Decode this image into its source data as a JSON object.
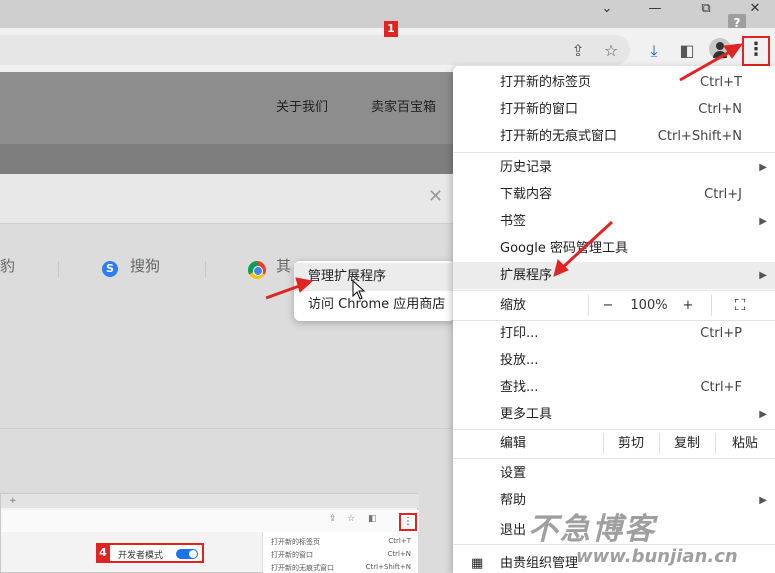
{
  "window": {
    "help": "?",
    "minimize": "⌄",
    "maximize": "—",
    "close": "⧉",
    "quit": "✕"
  },
  "toolbar": {
    "share_icon": "share-icon",
    "star_icon": "star-icon",
    "download_icon": "download-icon",
    "sidepanel_icon": "side-panel-icon",
    "menu_icon": "⋮"
  },
  "site": {
    "nav": [
      "关于我们",
      "卖家百宝箱"
    ]
  },
  "search": {
    "engines": [
      "豹",
      "搜狗",
      "其"
    ]
  },
  "extensions_submenu": {
    "items": [
      "管理扩展程序",
      "访问 Chrome 应用商店"
    ]
  },
  "menu": {
    "group1": [
      {
        "label": "打开新的标签页",
        "shortcut": "Ctrl+T"
      },
      {
        "label": "打开新的窗口",
        "shortcut": "Ctrl+N"
      },
      {
        "label": "打开新的无痕式窗口",
        "shortcut": "Ctrl+Shift+N"
      }
    ],
    "group2": [
      {
        "label": "历史记录",
        "shortcut": ""
      },
      {
        "label": "下载内容",
        "shortcut": "Ctrl+J"
      },
      {
        "label": "书签",
        "shortcut": ""
      },
      {
        "label": "Google 密码管理工具",
        "shortcut": ""
      },
      {
        "label": "扩展程序",
        "shortcut": ""
      }
    ],
    "zoom": {
      "label": "缩放",
      "minus": "−",
      "value": "100%",
      "plus": "+"
    },
    "group3": [
      {
        "label": "打印...",
        "shortcut": "Ctrl+P"
      },
      {
        "label": "投放...",
        "shortcut": ""
      },
      {
        "label": "查找...",
        "shortcut": "Ctrl+F"
      },
      {
        "label": "更多工具",
        "shortcut": ""
      }
    ],
    "edit": {
      "label": "编辑",
      "cut": "剪切",
      "copy": "复制",
      "paste": "粘贴"
    },
    "group4": [
      {
        "label": "设置"
      },
      {
        "label": "帮助"
      },
      {
        "label": "退出"
      }
    ],
    "managed": "由贵组织管理"
  },
  "mini": {
    "badge1": "1",
    "badge4": "4",
    "dev_mode": "开发者模式",
    "rows": [
      {
        "label": "打开新的标签页",
        "shortcut": "Ctrl+T"
      },
      {
        "label": "打开新的窗口",
        "shortcut": "Ctrl+N"
      },
      {
        "label": "打开新的无痕式窗口",
        "shortcut": "Ctrl+Shift+N"
      }
    ]
  },
  "watermark": {
    "text": "不急博客",
    "url": "www.bunjian.cn"
  },
  "colors": {
    "annotation_red": "#e02424",
    "toggle_blue": "#1a73e8"
  }
}
